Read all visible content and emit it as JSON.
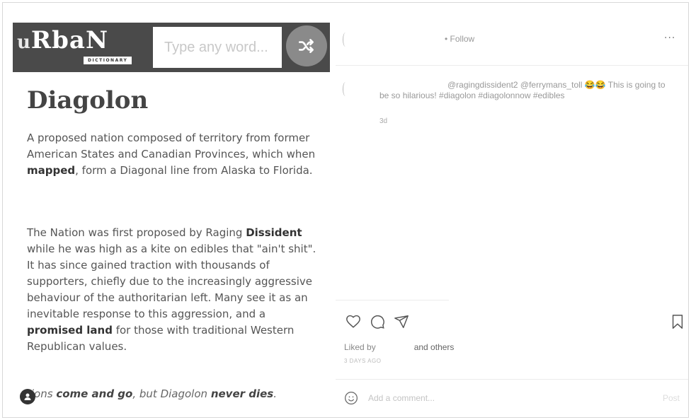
{
  "urban": {
    "logo_letter_u": "u",
    "logo_letters": "RbaN",
    "logo_sub": "DICTIONARY",
    "search_placeholder": "Type any word...",
    "shuffle_icon": "shuffle-icon",
    "word": "Diagolon",
    "definition_p1": [
      {
        "t": "A proposed nation composed of territory from former American States and Canadian Provinces, which when ",
        "b": false
      },
      {
        "t": "mapped",
        "b": true
      },
      {
        "t": ", form a Diagonal line from Alaska to Florida.",
        "b": false
      }
    ],
    "definition_p2": [
      {
        "t": "The Nation was first proposed by Raging ",
        "b": false
      },
      {
        "t": "Dissident",
        "b": true
      },
      {
        "t": " while he was high as a kite on edibles that \"ain't shit\". It has since gained traction with thousands of supporters, chiefly due to the increasingly aggressive behaviour of the authoritarian left. Many see it as an inevitable response to this aggression, and a ",
        "b": false
      },
      {
        "t": "promised land",
        "b": true
      },
      {
        "t": " for those with traditional Western Republican values.",
        "b": false
      }
    ],
    "example": [
      {
        "t": "tions ",
        "b": false
      },
      {
        "t": "come and go",
        "b": true
      },
      {
        "t": ", but Diagolon ",
        "b": false
      },
      {
        "t": "never dies",
        "b": true
      },
      {
        "t": ".",
        "b": false
      }
    ]
  },
  "instagram": {
    "follow_label": "• Follow",
    "more_label": "···",
    "caption_text": "@ragingdissident2 @ferrymans_toll 😂😂 This is going to be so hilarious! #diagolon #diagolonnow #edibles",
    "caption_time": "3d",
    "liked_by_label": "Liked by",
    "liked_others": "and others",
    "time_ago": "3 DAYS AGO",
    "comment_placeholder": "Add a comment...",
    "post_label": "Post"
  }
}
